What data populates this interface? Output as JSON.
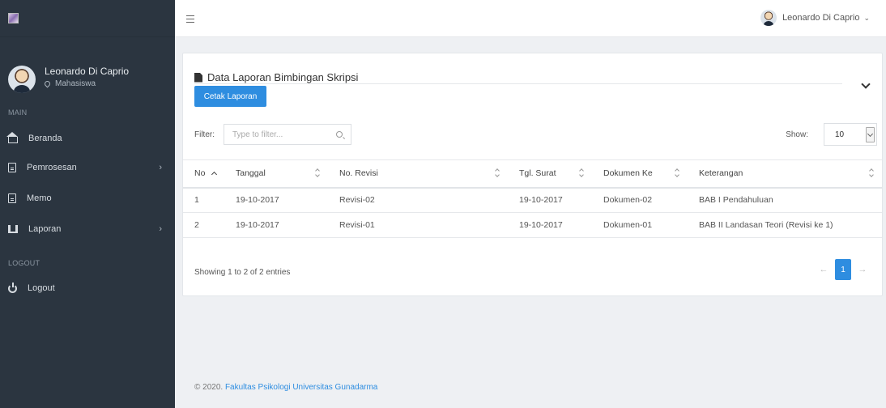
{
  "sidebar": {
    "user": {
      "name": "Leonardo Di Caprio",
      "role": "Mahasiswa"
    },
    "section_main": "MAIN",
    "items": [
      {
        "label": "Beranda",
        "icon": "home-icon",
        "has_submenu": false
      },
      {
        "label": "Pemrosesan",
        "icon": "calculator-icon",
        "has_submenu": true
      },
      {
        "label": "Memo",
        "icon": "note-icon",
        "has_submenu": false
      },
      {
        "label": "Laporan",
        "icon": "report-icon",
        "has_submenu": true
      }
    ],
    "section_logout": "LOGOUT",
    "logout_label": "Logout"
  },
  "topbar": {
    "user_name": "Leonardo Di Caprio",
    "chevron": "⌄"
  },
  "card": {
    "title": "Data Laporan Bimbingan Skripsi",
    "print_button": "Cetak Laporan",
    "filter_label": "Filter:",
    "filter_placeholder": "Type to filter...",
    "show_label": "Show:",
    "show_value": "10"
  },
  "table": {
    "headers": [
      "No",
      "Tanggal",
      "No. Revisi",
      "Tgl. Surat",
      "Dokumen Ke",
      "Keterangan"
    ],
    "rows": [
      [
        "1",
        "19-10-2017",
        "Revisi-02",
        "19-10-2017",
        "Dokumen-02",
        "BAB I Pendahuluan"
      ],
      [
        "2",
        "19-10-2017",
        "Revisi-01",
        "19-10-2017",
        "Dokumen-01",
        "BAB II Landasan Teori (Revisi ke 1)"
      ]
    ],
    "info": "Showing 1 to 2 of 2 entries",
    "pagination": {
      "prev": "←",
      "current": "1",
      "next": "→"
    }
  },
  "footer": {
    "prefix": "© 2020.",
    "link": "Fakultas Psikologi Universitas Gunadarma"
  },
  "colors": {
    "sidebar_bg": "#2b3540",
    "accent": "#2e8de0",
    "body_bg": "#eef0f3"
  }
}
